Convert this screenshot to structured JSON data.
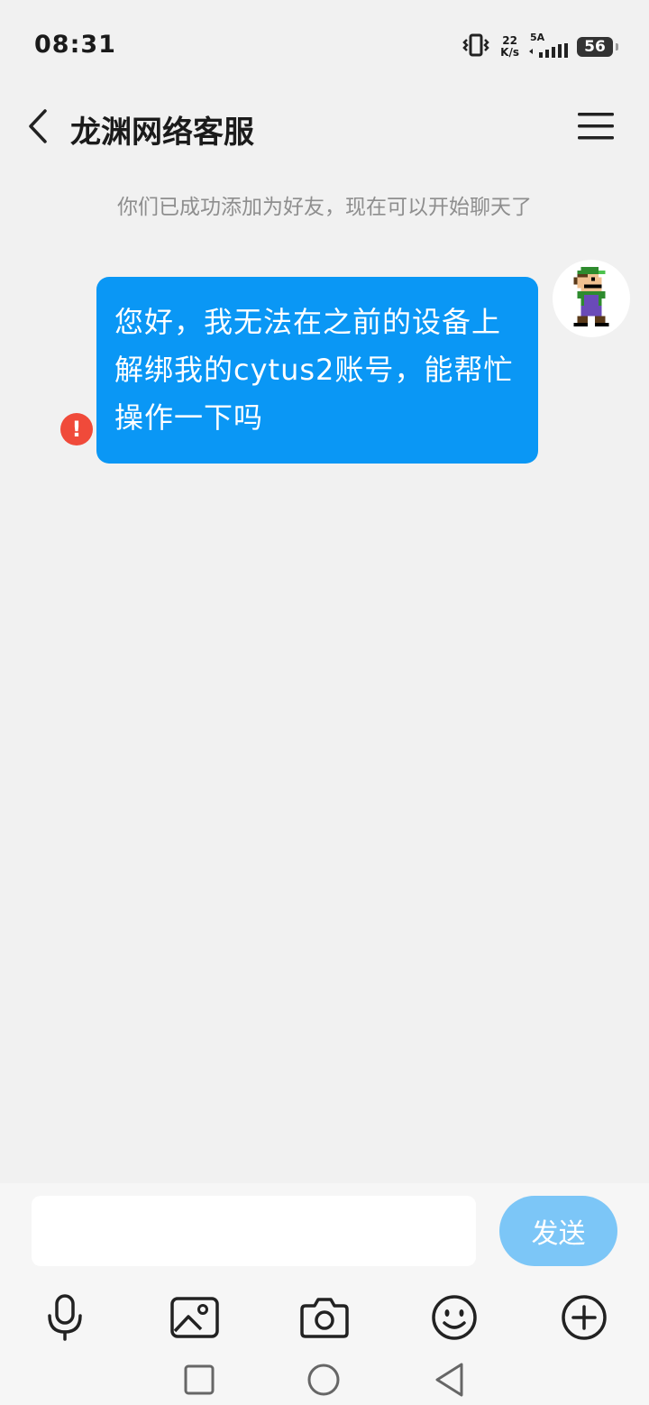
{
  "status_bar": {
    "time": "08:31",
    "net_speed_value": "22",
    "net_speed_unit": "K/s",
    "signal_label": "5A",
    "battery": "56"
  },
  "header": {
    "title": "龙渊网络客服"
  },
  "chat": {
    "system_notice": "你们已成功添加为好友，现在可以开始聊天了",
    "messages": [
      {
        "text": "您好，我无法在之前的设备上解绑我的cytus2账号，能帮忙操作一下吗",
        "status": "failed"
      }
    ]
  },
  "composer": {
    "input_value": "",
    "send_label": "发送"
  },
  "toolbar_icons": [
    "microphone-icon",
    "image-icon",
    "camera-icon",
    "emoji-icon",
    "plus-icon"
  ],
  "nav_icons": [
    "recent-apps-icon",
    "home-icon",
    "back-triangle-icon"
  ],
  "colors": {
    "bubble": "#0a97f5",
    "send_button": "#7cc6f7",
    "error": "#f04a3a",
    "background": "#f1f1f1"
  }
}
